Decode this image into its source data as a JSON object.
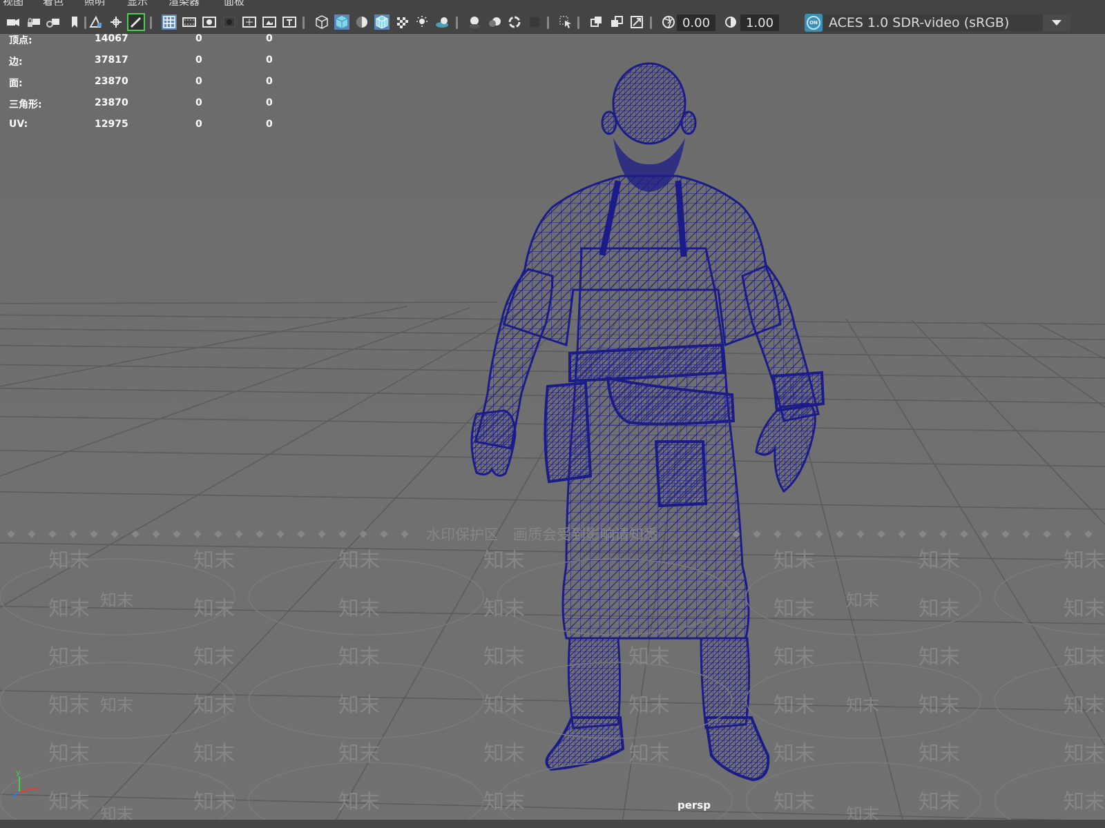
{
  "menubar": {
    "items": [
      "视图",
      "着色",
      "照明",
      "显示",
      "渲染器",
      "面板"
    ]
  },
  "toolbar": {
    "icons": [
      "camera-icon",
      "camera-lock-icon",
      "camera-attributes-icon",
      "bookmark-icon",
      "image-plane-icon",
      "2d-pan-zoom-icon",
      "grease-pencil-icon",
      "grid-icon",
      "film-gate-icon",
      "resolution-gate-icon",
      "gate-mask-icon",
      "field-chart-icon",
      "safe-action-icon",
      "safe-title-icon",
      "wireframe-icon",
      "smooth-shade-icon",
      "use-default-material-icon",
      "wireframe-on-shaded-icon",
      "xray-icon",
      "use-all-lights-icon",
      "shadows-icon",
      "screen-space-ao-icon",
      "motion-blur-icon",
      "anti-aliasing-icon",
      "depth-of-field-icon",
      "isolate-select-icon",
      "xray-joints-icon",
      "xray-active-components-icon",
      "backface-culling-icon",
      "exposure-icon",
      "gamma-icon",
      "color-management-icon"
    ],
    "exposure_value": "0.00",
    "gamma_value": "1.00",
    "color_mgmt_badge": "ON",
    "color_space": "ACES 1.0 SDR-video (sRGB)"
  },
  "hud": {
    "rows": [
      {
        "label": "顶点:",
        "v1": "14067",
        "v2": "0",
        "v3": "0"
      },
      {
        "label": "边:",
        "v1": "37817",
        "v2": "0",
        "v3": "0"
      },
      {
        "label": "面:",
        "v1": "23870",
        "v2": "0",
        "v3": "0"
      },
      {
        "label": "三角形:",
        "v1": "23870",
        "v2": "0",
        "v3": "0"
      },
      {
        "label": "UV:",
        "v1": "12975",
        "v2": "0",
        "v3": "0"
      }
    ]
  },
  "viewport": {
    "camera_name": "persp",
    "wireframe_color": "#1c1c88",
    "axis_labels": {
      "x": "x",
      "y": "y"
    }
  },
  "watermark": {
    "banner": "水印保护区　画质会受到影响请知悉",
    "tile": "知末"
  }
}
